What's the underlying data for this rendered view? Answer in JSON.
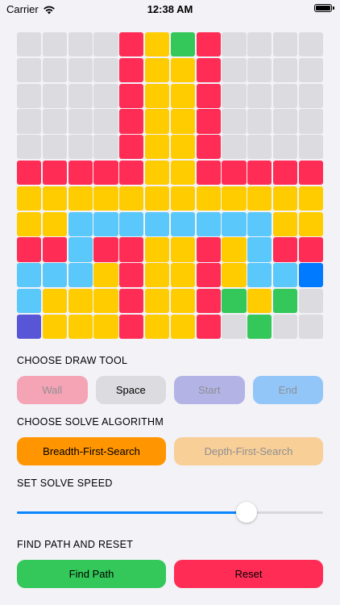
{
  "status_bar": {
    "carrier": "Carrier",
    "time": "12:38 AM"
  },
  "legend": {
    "W": "#ff2d55",
    "Y": "#ffcc00",
    "B": "#5ac8fa",
    "G": "#34c759",
    "X": "#dcdce0",
    "D": "#007aff",
    "P": "#5856d6"
  },
  "grid": [
    "XXXXWYGWXXXX",
    "XXXXWYYWXXXX",
    "XXXXWYYWXXXX",
    "XXXXWYYWXXXX",
    "XXXXWYYWXXXX",
    "WWWWWYYWWWWW",
    "YYYYYYYYYYYY",
    "YYBBBBBBBBYY",
    "WWBWWYYWYBWW",
    "BBBYWYYWYBBD",
    "BYYYWYYWGYGX",
    "PYYYWYYWXGXX"
  ],
  "draw_tool": {
    "label": "CHOOSE DRAW TOOL",
    "buttons": [
      {
        "label": "Wall",
        "bg": "#f5a4b6",
        "fg": "#8e8e93"
      },
      {
        "label": "Space",
        "bg": "#dcdce0",
        "fg": "#000000"
      },
      {
        "label": "Start",
        "bg": "#b4b3e6",
        "fg": "#8e8e93"
      },
      {
        "label": "End",
        "bg": "#93c6f8",
        "fg": "#8e8e93"
      }
    ]
  },
  "algorithm": {
    "label": "CHOOSE SOLVE ALGORITHM",
    "buttons": [
      {
        "label": "Breadth-First-Search",
        "bg": "#ff9500",
        "fg": "#000000"
      },
      {
        "label": "Depth-First-Search",
        "bg": "#f8cf97",
        "fg": "#8e8e93"
      }
    ]
  },
  "speed": {
    "label": "SET SOLVE SPEED",
    "value": 0.75
  },
  "actions": {
    "label": "FIND PATH AND RESET",
    "find_path": {
      "label": "Find Path",
      "bg": "#34c759"
    },
    "reset": {
      "label": "Reset",
      "bg": "#ff2d55"
    }
  }
}
